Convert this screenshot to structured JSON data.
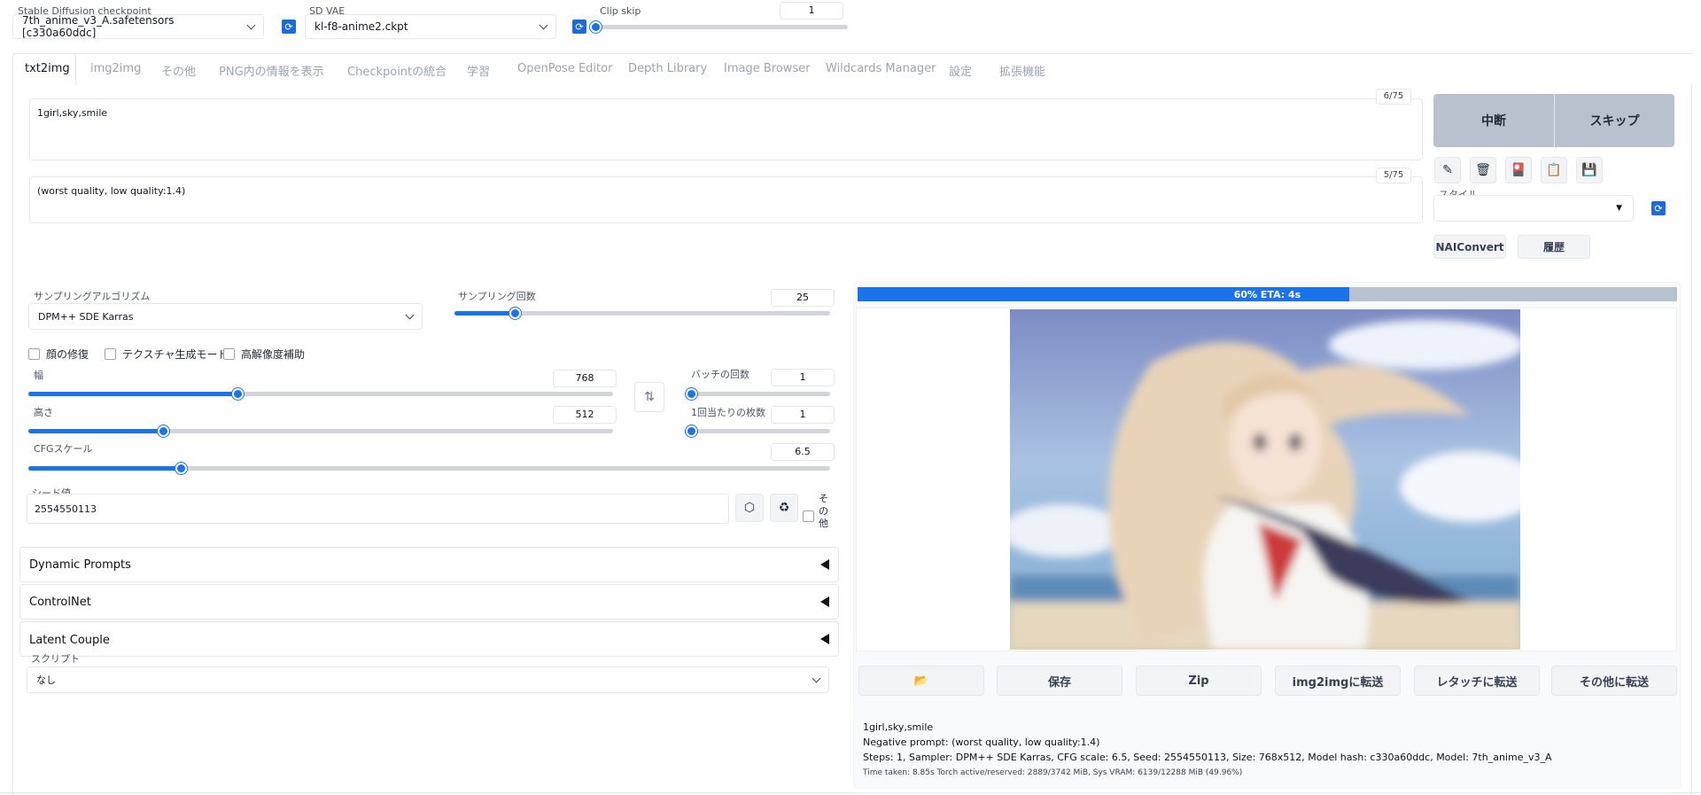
{
  "top": {
    "checkpoint_label": "Stable Diffusion checkpoint",
    "checkpoint_value": "7th_anime_v3_A.safetensors [c330a60ddc]",
    "vae_label": "SD VAE",
    "vae_value": "kl-f8-anime2.ckpt",
    "clip_label": "Clip skip",
    "clip_value": "1",
    "clip_fraction": 0.0
  },
  "tabs": [
    "txt2img",
    "img2img",
    "その他",
    "PNG内の情報を表示",
    "Checkpointの統合",
    "学習",
    "OpenPose Editor",
    "Depth Library",
    "Image Browser",
    "Wildcards Manager",
    "設定",
    "拡張機能"
  ],
  "prompt": {
    "value": "1girl,sky,smile",
    "counter": "6/75"
  },
  "negative": {
    "value": "(worst quality, low quality:1.4)",
    "counter": "5/75"
  },
  "actions": {
    "interrupt": "中断",
    "skip": "スキップ",
    "style_label": "スタイル",
    "naiconvert": "NAIConvert",
    "history": "履歴"
  },
  "sampling": {
    "method_label": "サンプリングアルゴリズム",
    "method_value": "DPM++ SDE Karras",
    "steps_label": "サンプリング回数",
    "steps_value": "25",
    "steps_fraction": 0.16
  },
  "checkboxes": {
    "face": "顔の修復",
    "tiling": "テクスチャ生成モード",
    "hires": "高解像度補助"
  },
  "size": {
    "width_label": "幅",
    "width_value": "768",
    "width_fraction": 0.357,
    "height_label": "高さ",
    "height_value": "512",
    "height_fraction": 0.231
  },
  "batch": {
    "count_label": "バッチの回数",
    "count_value": "1",
    "size_label": "1回当たりの枚数",
    "size_value": "1"
  },
  "cfg": {
    "label": "CFGスケール",
    "value": "6.5",
    "fraction": 0.19
  },
  "seed": {
    "label": "シード値",
    "value": "2554550113",
    "extra_label": "その他"
  },
  "accordions": [
    "Dynamic Prompts",
    "ControlNet",
    "Latent Couple"
  ],
  "script": {
    "label": "スクリプト",
    "value": "なし"
  },
  "progress": {
    "text": "60% ETA: 4s",
    "fraction": 0.6
  },
  "output_buttons": {
    "save": "保存",
    "zip": "Zip",
    "to_img2img": "img2imgに転送",
    "to_inpaint": "レタッチに転送",
    "to_extras": "その他に転送"
  },
  "info": {
    "line1": "1girl,sky,smile",
    "line2": "Negative prompt: (worst quality, low quality:1.4)",
    "line3": "Steps: 1, Sampler: DPM++ SDE Karras, CFG scale: 6.5, Seed: 2554550113, Size: 768x512, Model hash: c330a60ddc, Model: 7th_anime_v3_A",
    "line4": "Time taken: 8.85s  Torch active/reserved: 2889/3742 MiB, Sys VRAM: 6139/12288 MiB (49.96%)"
  },
  "icons": {
    "refresh": "refresh-icon",
    "pen": "pen-icon",
    "trash": "trash-icon",
    "card": "card-icon",
    "clipboard": "clipboard-icon",
    "save": "floppy-icon",
    "swap": "swap-icon",
    "dice": "dice-icon",
    "recycle": "recycle-icon",
    "folder": "folder-icon"
  }
}
